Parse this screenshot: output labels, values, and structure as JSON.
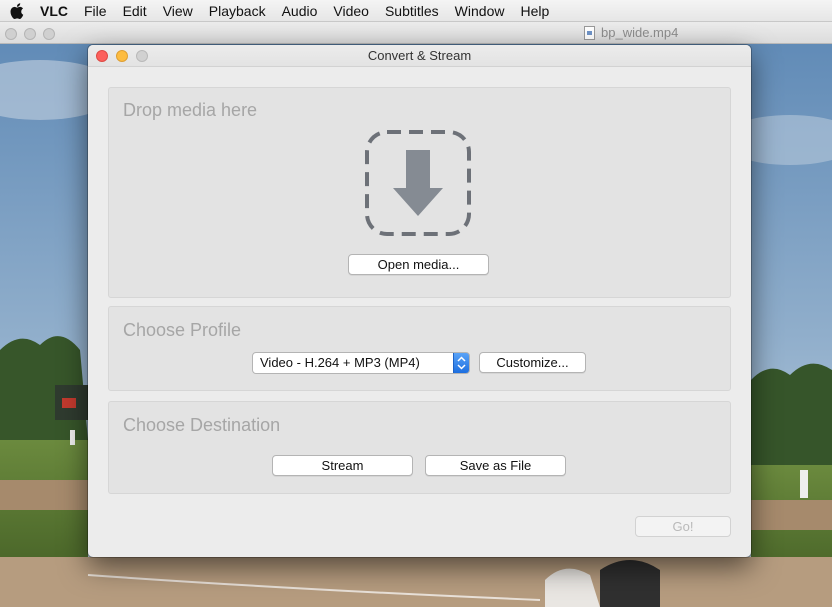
{
  "menubar": {
    "app_name": "VLC",
    "items": [
      "File",
      "Edit",
      "View",
      "Playback",
      "Audio",
      "Video",
      "Subtitles",
      "Window",
      "Help"
    ]
  },
  "player": {
    "filename": "bp_wide.mp4"
  },
  "dialog": {
    "title": "Convert & Stream",
    "drop_section": {
      "title": "Drop media here",
      "open_button": "Open media...",
      "icon": "download-arrow-icon"
    },
    "profile_section": {
      "title": "Choose Profile",
      "selected_profile": "Video - H.264 + MP3 (MP4)",
      "customize_button": "Customize..."
    },
    "destination_section": {
      "title": "Choose Destination",
      "stream_button": "Stream",
      "save_button": "Save as File"
    },
    "go_button": "Go!"
  },
  "colors": {
    "close": "#fc605c",
    "minimize": "#fdbc40",
    "accent": "#1d6fe0"
  }
}
